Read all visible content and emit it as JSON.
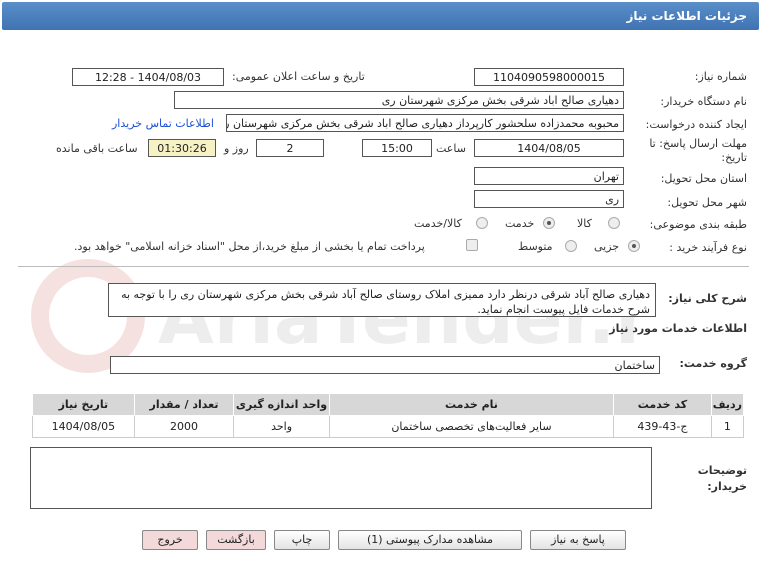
{
  "title": "جزئیات اطلاعات نیاز",
  "need_number": {
    "label": "شماره نیاز:",
    "value": "1104090598000015"
  },
  "announce_datetime": {
    "label": "تاریخ و ساعت اعلان عمومی:",
    "value": "1404/08/03 - 12:28"
  },
  "buyer_org": {
    "label": "نام دستگاه خریدار:",
    "value": "دهیاری صالح اباد شرقی بخش مرکزی شهرستان ری"
  },
  "requester": {
    "label": "ایجاد کننده درخواست:",
    "value": "محبوبه محمدزاده سلحشور کارپرداز دهیاری صالح اباد شرقی بخش مرکزی شهرستان ری",
    "contact_link": "اطلاعات تماس خریدار"
  },
  "deadline": {
    "label_line1": "مهلت ارسال پاسخ: تا",
    "label_line2": "تاریخ:",
    "date": "1404/08/05",
    "time_label": "ساعت",
    "time": "15:00",
    "days": "2",
    "days_label": "روز و",
    "remaining": "01:30:26",
    "remaining_label": "ساعت باقی مانده"
  },
  "province": {
    "label": "استان محل تحویل:",
    "value": "تهران"
  },
  "city": {
    "label": "شهر محل تحویل:",
    "value": "ری"
  },
  "category": {
    "label": "طبقه بندی موضوعی:",
    "options": [
      "کالا",
      "خدمت",
      "کالا/خدمت"
    ],
    "selected": "خدمت"
  },
  "process": {
    "label": "نوع فرآیند خرید :",
    "options": [
      "جزیی",
      "متوسط"
    ],
    "selected": "جزیی",
    "payment_note": "پرداخت تمام یا بخشی از مبلغ خرید،از محل \"اسناد خزانه اسلامی\" خواهد بود."
  },
  "general_desc": {
    "label": "شرح کلی نیاز:",
    "value": "دهیاری صالح آباد شرقی درنظر دارد ممیزی املاک روستای صالح آباد شرقی بخش مرکزی شهرستان ری را با توجه به شرح خدمات فایل پیوست انجام نماید."
  },
  "services_heading": "اطلاعات خدمات مورد نیاز",
  "service_group": {
    "label": "گروه خدمت:",
    "value": "ساختمان"
  },
  "table": {
    "headers": [
      "ردیف",
      "کد خدمت",
      "نام خدمت",
      "واحد اندازه گیری",
      "تعداد / مقدار",
      "تاریخ نیاز"
    ],
    "rows": [
      [
        "1",
        "ج-43-439",
        "سایر فعالیت‌های تخصصی ساختمان",
        "واحد",
        "2000",
        "1404/08/05"
      ]
    ]
  },
  "buyer_notes": {
    "label_line1": "توضیحات",
    "label_line2": "خریدار:",
    "value": ""
  },
  "buttons": {
    "reply": "پاسخ به نیاز",
    "attachments": "مشاهده مدارک پیوستی (1)",
    "print": "چاپ",
    "back": "بازگشت",
    "exit": "خروج"
  },
  "watermark": "AriaTender.net"
}
